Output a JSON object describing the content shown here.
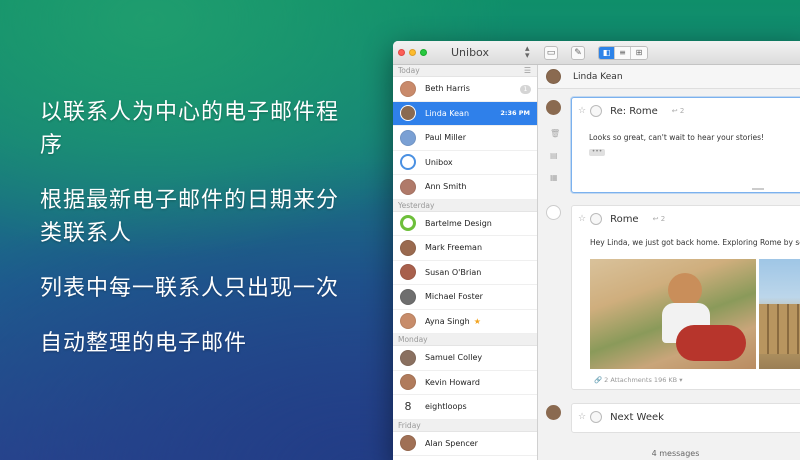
{
  "features": [
    "以联系人为中心的电子邮件程序",
    "根据最新电子邮件的日期来分类联系人",
    "列表中每一联系人只出现一次",
    "自动整理的电子邮件"
  ],
  "window": {
    "title": "Unibox",
    "traffic_lights": [
      "close",
      "minimize",
      "zoom"
    ],
    "toolbar": {
      "sort_icon": "sort-updown-icon",
      "left_buttons": [
        "sidebar-toggle-icon",
        "compose-icon"
      ],
      "view_modes": [
        "conversation-view-icon",
        "list-view-icon",
        "grid-view-icon"
      ],
      "active_view": "conversation-view-icon"
    }
  },
  "sidebar": {
    "filter_icon": "filter-icon",
    "sections": [
      {
        "label": "Today",
        "contacts": [
          {
            "name": "Beth Harris",
            "badge": "1",
            "avatar_color": "#c98a6b"
          },
          {
            "name": "Linda Kean",
            "time": "2:36 PM",
            "selected": true,
            "avatar_color": "#8a6a50"
          },
          {
            "name": "Paul Miller",
            "avatar_color": "#7aa0d4"
          },
          {
            "name": "Unibox",
            "avatar_color": "#4a90e2"
          },
          {
            "name": "Ann Smith",
            "avatar_color": "#b07a6a"
          }
        ]
      },
      {
        "label": "Yesterday",
        "contacts": [
          {
            "name": "Bartelme Design",
            "avatar_color": "#6dbf3a"
          },
          {
            "name": "Mark Freeman",
            "avatar_color": "#9a6a4f"
          },
          {
            "name": "Susan O'Brian",
            "avatar_color": "#a8604c"
          },
          {
            "name": "Michael Foster",
            "avatar_color": "#6e6e6e"
          },
          {
            "name": "Ayna Singh",
            "star": "★",
            "avatar_color": "#c78c6a"
          }
        ]
      },
      {
        "label": "Monday",
        "contacts": [
          {
            "name": "Samuel Colley",
            "avatar_color": "#8a7060"
          },
          {
            "name": "Kevin Howard",
            "avatar_color": "#b07b5c"
          },
          {
            "name": "eightloops",
            "avatar_color": "#ffffff"
          }
        ]
      },
      {
        "label": "Friday",
        "contacts": [
          {
            "name": "Alan Spencer",
            "avatar_color": "#a07055"
          }
        ]
      }
    ]
  },
  "conversation": {
    "contact_name": "Linda Kean",
    "messages": [
      {
        "subject": "Re: Rome",
        "replies": "2",
        "body": "Looks so great, can't wait to hear your stories!",
        "ellipsis": "•••",
        "active": true
      },
      {
        "subject": "Rome",
        "replies": "2",
        "body": "Hey Linda, we just got back home. Exploring Rome by scooter is",
        "attachments": "2 Attachments 196 KB"
      },
      {
        "subject": "Next Week"
      }
    ],
    "footer": "4 messages"
  }
}
